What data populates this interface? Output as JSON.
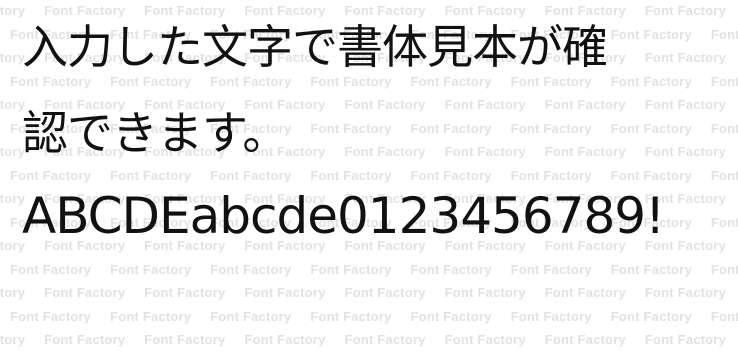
{
  "watermark": {
    "text": "Font Factory",
    "color": "#e2e2e2"
  },
  "sample": {
    "lines": [
      "入力した文字で書体見本が確",
      "認できます。",
      "ABCDEabcde0123456789!"
    ],
    "text_color": "#111111"
  }
}
